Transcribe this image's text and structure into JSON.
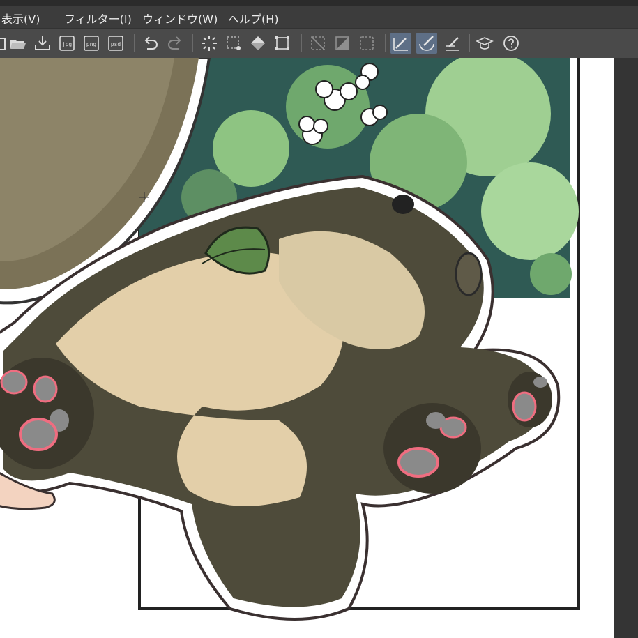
{
  "menu": {
    "items": [
      {
        "label": "表示(V)"
      },
      {
        "label": "フィルター(I)"
      },
      {
        "label": "ウィンドウ(W)"
      },
      {
        "label": "ヘルプ(H)"
      }
    ]
  },
  "toolbar": {
    "tools": [
      {
        "icon": "new-canvas-icon"
      },
      {
        "icon": "open-folder-icon"
      },
      {
        "icon": "import-icon"
      },
      {
        "icon": "export-jpg-icon",
        "label": "jpg"
      },
      {
        "icon": "export-png-icon",
        "label": "png"
      },
      {
        "icon": "export-psd-icon",
        "label": "psd"
      },
      {
        "icon": "undo-icon"
      },
      {
        "icon": "redo-icon"
      },
      {
        "icon": "auto-select-icon"
      },
      {
        "icon": "selection-area-icon"
      },
      {
        "icon": "fill-icon"
      },
      {
        "icon": "transform-icon"
      },
      {
        "icon": "clear-outside-icon"
      },
      {
        "icon": "clear-inside-icon"
      },
      {
        "icon": "deselect-icon"
      },
      {
        "icon": "pen-ruler-icon",
        "active": true
      },
      {
        "icon": "snap-ruler-icon",
        "active": true
      },
      {
        "icon": "snap-grid-icon"
      },
      {
        "icon": "learn-icon"
      },
      {
        "icon": "help-icon"
      }
    ]
  },
  "canvas": {
    "description_colors": {
      "background": "#ffffff",
      "foliage_dark": "#2f5a54",
      "foliage_light": "#9fcf92",
      "fur_dark": "#4e4b3a",
      "fur_light": "#e3cfa9",
      "paw_pad": "#8a8a8a",
      "paw_pink": "#ef6d80",
      "leaf": "#5d8a4a"
    }
  }
}
